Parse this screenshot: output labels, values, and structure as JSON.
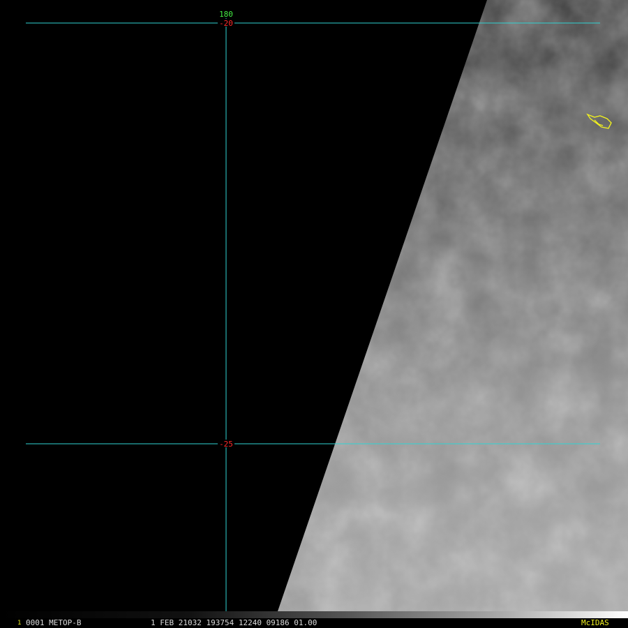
{
  "map": {
    "grid": {
      "longitude_label": "180",
      "latitude_labels": [
        "-20",
        "-25"
      ]
    },
    "colors": {
      "grid_line": "#2fd3d3",
      "longitude_label": "#44ee44",
      "latitude_label": "#ff2a2a",
      "coastline": "#f0f020",
      "background": "#000000"
    }
  },
  "status_bar": {
    "frame_marker": "1",
    "info": "0001 METOP-B",
    "datetime": "1 FEB 21032 193754 12240 09186 01.00",
    "brand": "McIDAS"
  }
}
